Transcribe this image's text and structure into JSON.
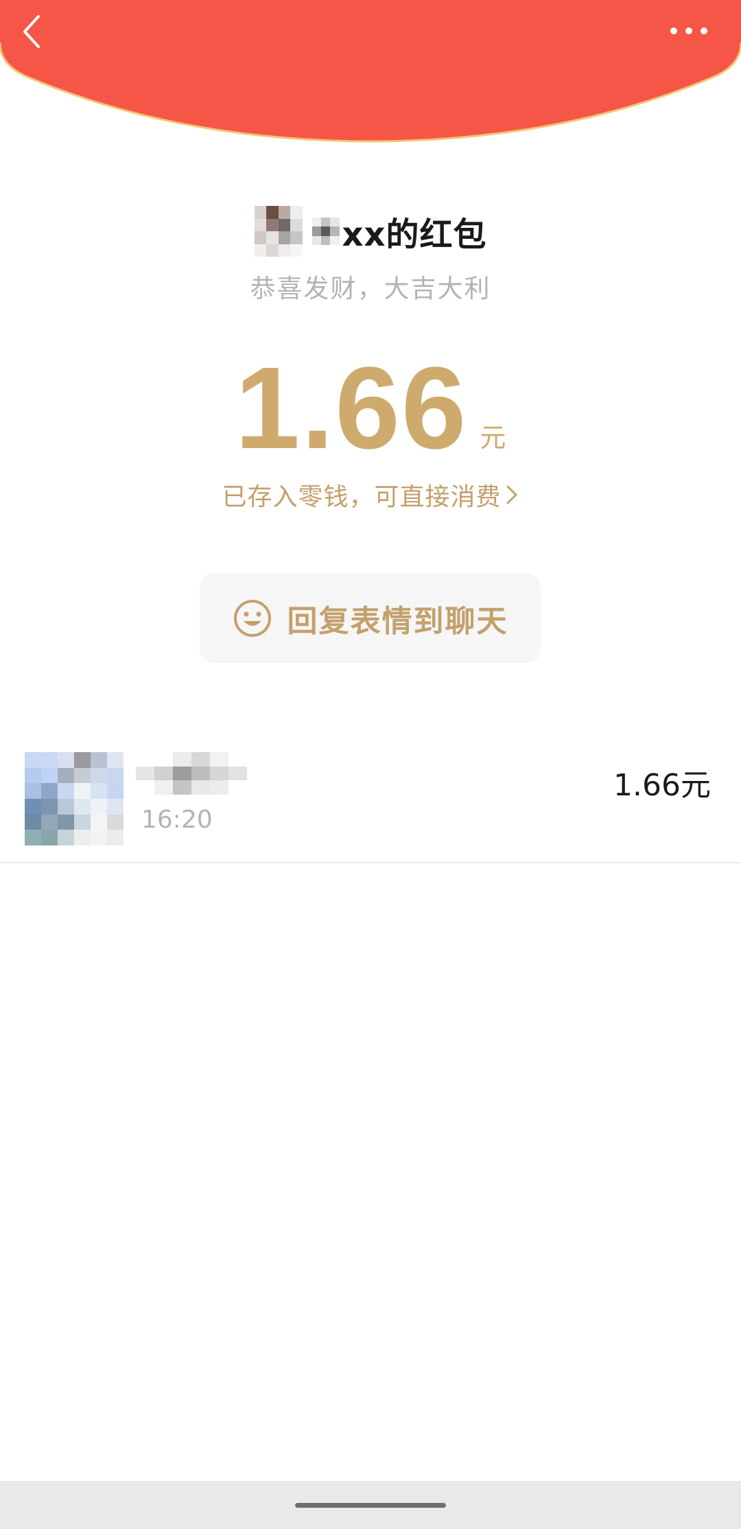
{
  "header": {
    "back_icon": "chevron-left-icon",
    "more_icon": "more-horizontal-icon",
    "color": "#f55647",
    "border_color": "#f5c370"
  },
  "envelope": {
    "sender_suffix": "xx的红包",
    "blessing": "恭喜发财，大吉大利",
    "amount": "1.66",
    "unit": "元",
    "stored_text": "已存入零钱，可直接消费",
    "accent_color": "#cfaa6e"
  },
  "reply": {
    "label": "回复表情到聊天",
    "icon": "smile-icon"
  },
  "records": [
    {
      "time": "16:20",
      "amount": "1.66元"
    }
  ]
}
